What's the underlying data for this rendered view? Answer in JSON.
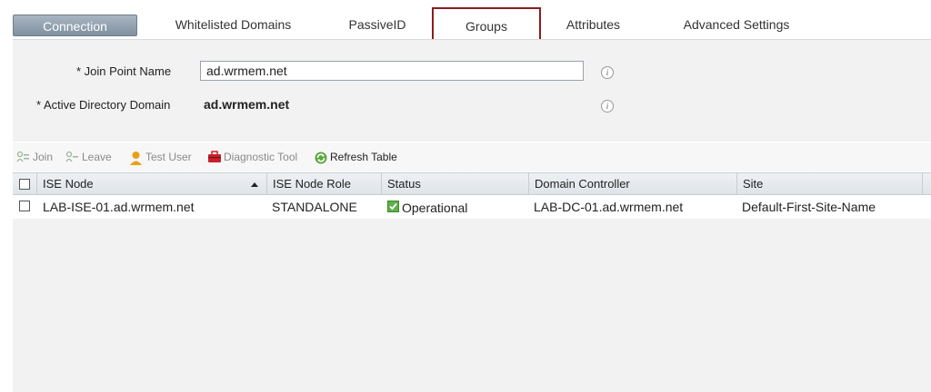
{
  "tabs": [
    {
      "label": "Connection"
    },
    {
      "label": "Whitelisted Domains"
    },
    {
      "label": "PassiveID"
    },
    {
      "label": "Groups"
    },
    {
      "label": "Attributes"
    },
    {
      "label": "Advanced Settings"
    }
  ],
  "form": {
    "join_point_label": "* Join Point Name",
    "join_point_value": "ad.wrmem.net",
    "ad_domain_label": "* Active Directory Domain",
    "ad_domain_value": "ad.wrmem.net",
    "info_glyph": "i"
  },
  "toolbar": {
    "join": "Join",
    "leave": "Leave",
    "test_user": "Test User",
    "diagnostic_tool": "Diagnostic Tool",
    "refresh_table": "Refresh Table"
  },
  "table": {
    "columns": [
      "ISE Node",
      "ISE Node Role",
      "Status",
      "Domain Controller",
      "Site"
    ],
    "rows": [
      {
        "ise_node": "LAB-ISE-01.ad.wrmem.net",
        "role": "STANDALONE",
        "status": "Operational",
        "domain_controller": "LAB-DC-01.ad.wrmem.net",
        "site": "Default-First-Site-Name"
      }
    ]
  },
  "colors": {
    "active_tab": "#8f9fae",
    "highlight_border": "#8b1e1e",
    "status_ok": "#3a9a2a"
  }
}
